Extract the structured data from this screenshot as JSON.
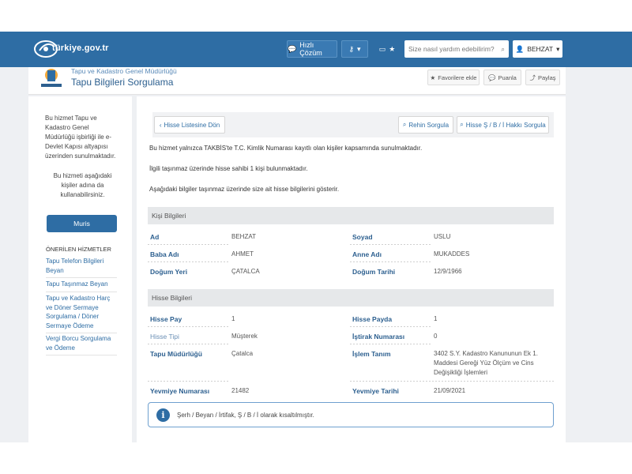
{
  "header": {
    "logo_text": "türkiye.gov.tr",
    "quick_solution": "Hızlı Çözüm",
    "search_placeholder": "Size nasıl yardım edebilirim?",
    "user": "BEHZAT"
  },
  "service": {
    "org": "Tapu ve Kadastro Genel Müdürlüğü",
    "title": "Tapu Bilgileri Sorgulama",
    "favorites": "Favorilere ekle",
    "rate": "Puanla",
    "share": "Paylaş"
  },
  "sidebar": {
    "note1": "Bu hizmet Tapu ve Kadastro Genel Müdürlüğü işbirliği ile e-Devlet Kapısı altyapısı üzerinden sunulmaktadır.",
    "note2": "Bu hizmeti aşağıdaki kişiler adına da kullanabilirsiniz.",
    "muris": "Muris",
    "recommended_title": "ÖNERİLEN HİZMETLER",
    "recommended": [
      "Tapu Telefon Bilgileri Beyan",
      "Tapu Taşınmaz Beyan",
      "Tapu ve Kadastro Harç ve Döner Sermaye Sorgulama / Döner Sermaye Ödeme",
      "Vergi Borcu Sorgulama ve Ödeme"
    ]
  },
  "actions": {
    "back": "Hisse Listesine Dön",
    "rehin": "Rehin Sorgula",
    "hisse": "Hisse Ş / B / İ Hakkı Sorgula"
  },
  "texts": {
    "p1": "Bu hizmet yalnızca TAKBİS'te T.C. Kimlik Numarası kayıtlı olan kişiler kapsamında sunulmaktadır.",
    "p2": "İlgili taşınmaz üzerinde hisse sahibi 1 kişi bulunmaktadır.",
    "p3": "Aşağıdaki bilgiler taşınmaz üzerinde size ait hisse bilgilerini gösterir."
  },
  "person": {
    "title": "Kişi Bilgileri",
    "ad_label": "Ad",
    "ad": "BEHZAT",
    "soyad_label": "Soyad",
    "soyad": "USLU",
    "baba_label": "Baba Adı",
    "baba": "AHMET",
    "anne_label": "Anne Adı",
    "anne": "MUKADDES",
    "dyeri_label": "Doğum Yeri",
    "dyeri": "ÇATALCA",
    "dtarih_label": "Doğum Tarihi",
    "dtarih": "12/9/1966"
  },
  "share": {
    "title": "Hisse Bilgileri",
    "pay_label": "Hisse Pay",
    "pay": "1",
    "payda_label": "Hisse Payda",
    "payda": "1",
    "tip_label": "Hisse Tipi",
    "tip": "Müşterek",
    "istirak_label": "İştirak Numarası",
    "istirak": "0",
    "mudurluk_label": "Tapu Müdürlüğü",
    "mudurluk": "Çatalca",
    "islem_label": "İşlem Tanım",
    "islem": "3402 S.Y. Kadastro Kanununun Ek 1. Maddesi Gereği Yüz Ölçüm ve Cins Değişikliği İşlemleri",
    "yno_label": "Yevmiye Numarası",
    "yno": "21482",
    "ytarih_label": "Yevmiye Tarihi",
    "ytarih": "21/09/2021"
  },
  "info": "Şerh / Beyan / İrtifak, Ş / B / İ olarak kısaltılmıştır."
}
